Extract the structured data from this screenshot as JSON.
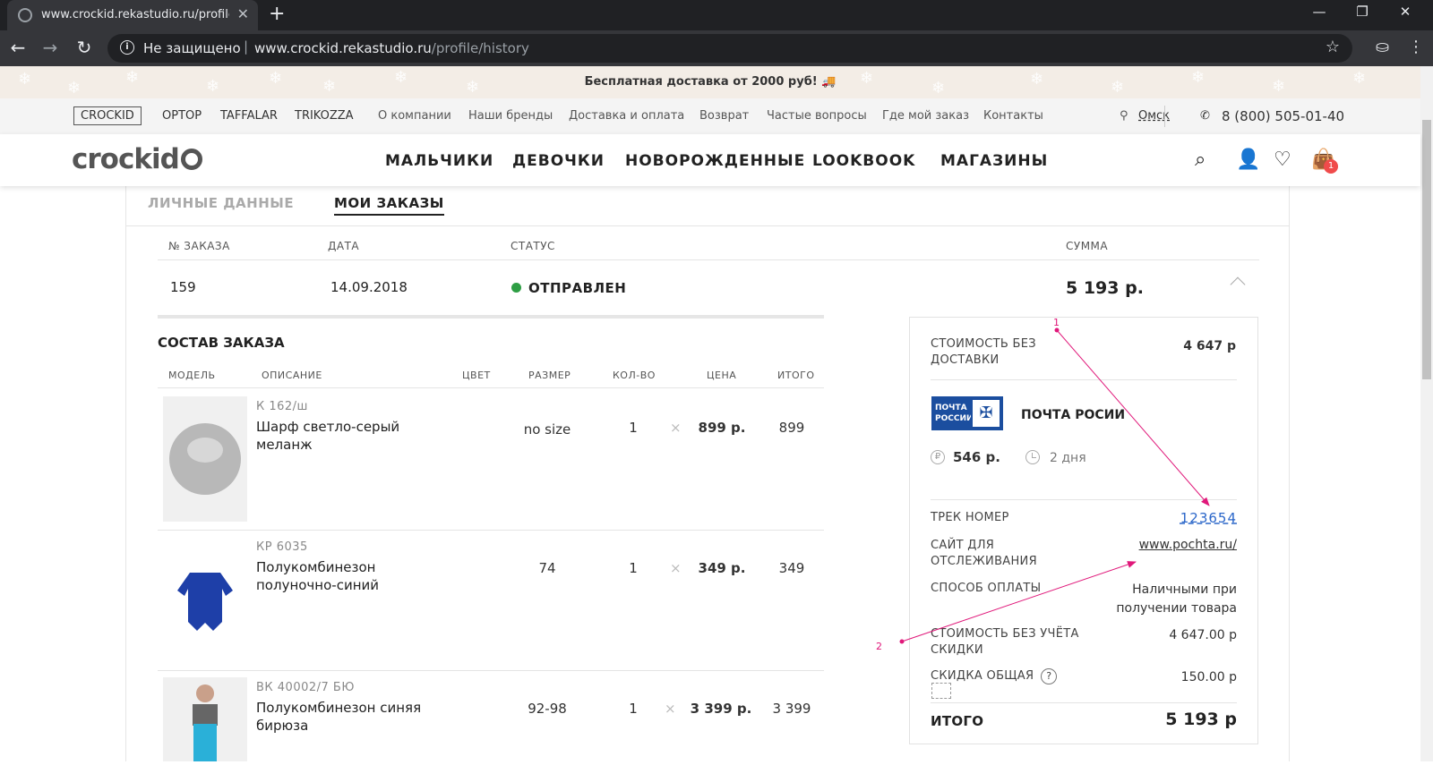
{
  "browser": {
    "tab_title": "www.crockid.rekastudio.ru/profile/history",
    "security_label": "Не защищено",
    "url_domain": "www.crockid.rekastudio.ru",
    "url_path": "/profile/history"
  },
  "promo": {
    "text": "Бесплатная доставка от 2000 руб!"
  },
  "topnav": {
    "items": [
      "CROCKID",
      "OPTOP",
      "TAFFALAR",
      "TRIKOZZA",
      "О компании",
      "Наши бренды",
      "Доставка и оплата",
      "Возврат",
      "Частые вопросы",
      "Где мой заказ",
      "Контакты"
    ],
    "city": "Омск",
    "phone": "8 (800) 505-01-40"
  },
  "header": {
    "logo": "crockid",
    "nav": [
      "МАЛЬЧИКИ",
      "ДЕВОЧКИ",
      "НОВОРОЖДЕННЫЕ",
      "LOOKBOOK",
      "МАГАЗИНЫ"
    ],
    "cart_count": "1"
  },
  "profile_tabs": [
    "ЛИЧНЫЕ ДАННЫЕ",
    "МОИ ЗАКАЗЫ"
  ],
  "orders": {
    "columns": [
      "№ ЗАКАЗА",
      "ДАТА",
      "СТАТУС",
      "СУММА"
    ],
    "order": {
      "number": "159",
      "date": "14.09.2018",
      "status": "ОТПРАВЛЕН",
      "sum": "5 193 р."
    }
  },
  "composition": {
    "title": "СОСТАВ ЗАКАЗА",
    "columns": [
      "МОДЕЛЬ",
      "ОПИСАНИЕ",
      "ЦВЕТ",
      "РАЗМЕР",
      "КОЛ-ВО",
      "ЦЕНА",
      "ИТОГО"
    ],
    "items": [
      {
        "sku": "К 162/ш",
        "name": "Шарф светло-серый меланж",
        "size": "no size",
        "qty": "1",
        "x": "×",
        "price": "899 р.",
        "total": "899"
      },
      {
        "sku": "КР 6035",
        "name": "Полукомбинезон полуночно-синий",
        "size": "74",
        "qty": "1",
        "x": "×",
        "price": "349 р.",
        "total": "349"
      },
      {
        "sku": "ВК 40002/7 БЮ",
        "name": "Полукомбинезон синяя бирюза",
        "size": "92-98",
        "qty": "1",
        "x": "×",
        "price": "3 399 р.",
        "total": "3 399"
      }
    ]
  },
  "summary": {
    "cost_wo_delivery_label": "СТОИМОСТЬ БЕЗ ДОСТАВКИ",
    "cost_wo_delivery": "4 647 р",
    "post_logo": "ПОЧТА РОССИИ",
    "post_name": "ПОЧТА РОСИИ",
    "delivery_price": "546 р.",
    "delivery_time": "2 дня",
    "track_label": "ТРЕК НОМЕР",
    "track_number": "123654",
    "site_label": "САЙТ ДЛЯ ОТСЛЕЖИВАНИЯ",
    "site": "www.pochta.ru/",
    "payment_label": "СПОСОБ ОПЛАТЫ",
    "payment": "Наличными при получении товара",
    "cost_no_discount_label": "СТОИМОСТЬ БЕЗ УЧЁТА СКИДКИ",
    "cost_no_discount": "4 647.00 р",
    "discount_label": "СКИДКА ОБЩАЯ",
    "discount": "150.00 р",
    "total_label": "ИТОГО",
    "total": "5 193 р"
  },
  "annotations": [
    "1",
    "2"
  ],
  "colors": {
    "accent": "#2a66c9",
    "status_green": "#2e9e44",
    "badge": "#f04b4b",
    "annotation": "#e0187a"
  }
}
